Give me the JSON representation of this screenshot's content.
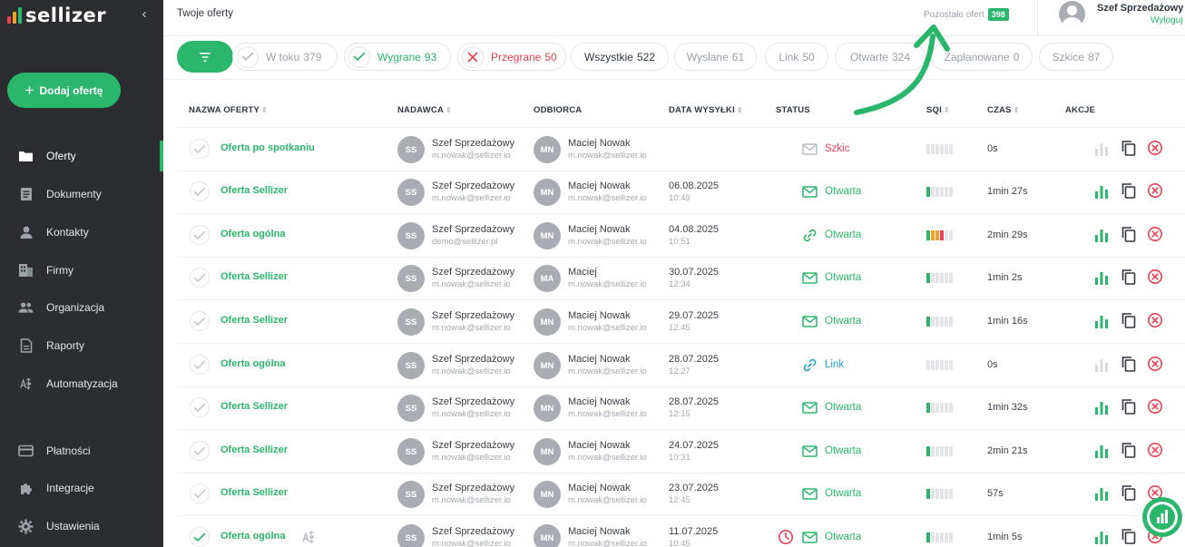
{
  "app": {
    "name": "sellizer"
  },
  "sidebar": {
    "add_offer_label": "Dodaj ofertę",
    "items": [
      {
        "label": "Oferty",
        "icon": "folder-icon",
        "active": true
      },
      {
        "label": "Dokumenty",
        "icon": "document-icon",
        "active": false
      },
      {
        "label": "Kontakty",
        "icon": "person-icon",
        "active": false
      },
      {
        "label": "Firmy",
        "icon": "building-icon",
        "active": false
      },
      {
        "label": "Organizacja",
        "icon": "group-icon",
        "active": false
      },
      {
        "label": "Raporty",
        "icon": "report-icon",
        "active": false
      },
      {
        "label": "Automatyzacja",
        "icon": "automation-icon",
        "active": false
      },
      {
        "label": "Płatności",
        "icon": "card-icon",
        "active": false
      },
      {
        "label": "Integracje",
        "icon": "puzzle-icon",
        "active": false
      },
      {
        "label": "Ustawienia",
        "icon": "gear-icon",
        "active": false
      }
    ]
  },
  "header": {
    "title": "Twoje oferty",
    "remaining_label": "Pozostało ofert",
    "remaining_count": "398",
    "user_name": "Szef Sprzedażowy",
    "logout_label": "Wyloguj"
  },
  "filters": [
    {
      "label": "W toku",
      "count": "379",
      "icon": "check-icon"
    },
    {
      "label": "Wygrane",
      "count": "93",
      "icon": "check-icon"
    },
    {
      "label": "Przegrane",
      "count": "50",
      "icon": "x-icon"
    },
    {
      "label": "Wszystkie",
      "count": "522",
      "icon": "",
      "active": true
    },
    {
      "label": "Wysłane",
      "count": "61",
      "icon": ""
    },
    {
      "label": "Link",
      "count": "50",
      "icon": ""
    },
    {
      "label": "Otwarte",
      "count": "324",
      "icon": ""
    },
    {
      "label": "Zaplanowane",
      "count": "0",
      "icon": ""
    },
    {
      "label": "Szkice",
      "count": "87",
      "icon": ""
    }
  ],
  "table": {
    "columns": [
      "NAZWA OFERTY",
      "NADAWCA",
      "ODBIORCA",
      "DATA WYSYŁKI",
      "STATUS",
      "SQI",
      "CZAS",
      "AKCJE"
    ],
    "rows": [
      {
        "name": "Oferta po spotkaniu",
        "sender_initials": "SS",
        "sender_name": "Szef Sprzedażowy",
        "sender_email": "m.nowak@sellizer.io",
        "recipient_initials": "MN",
        "recipient_name": "Maciej Nowak",
        "recipient_email": "m.nowak@sellizer.io",
        "date": "",
        "time": "",
        "status": "Szkic",
        "status_type": "draft",
        "status_icon": "envelope-icon",
        "sqi": 0,
        "duration": "0s",
        "stats_active": false,
        "checked": false,
        "automation": false,
        "scheduled": false
      },
      {
        "name": "Oferta Sellizer",
        "sender_initials": "SS",
        "sender_name": "Szef Sprzedażowy",
        "sender_email": "m.nowak@sellizer.io",
        "recipient_initials": "MN",
        "recipient_name": "Maciej Nowak",
        "recipient_email": "m.nowak@sellizer.io",
        "date": "06.08.2025",
        "time": "10:49",
        "status": "Otwarta",
        "status_type": "opened",
        "status_icon": "envelope-icon",
        "sqi": 1,
        "duration": "1min 27s",
        "stats_active": true,
        "checked": false,
        "automation": false,
        "scheduled": false
      },
      {
        "name": "Oferta ogólna",
        "sender_initials": "SS",
        "sender_name": "Szef Sprzedażowy",
        "sender_email": "demo@sellizer.pl",
        "recipient_initials": "MN",
        "recipient_name": "Maciej Nowak",
        "recipient_email": "m.nowak@sellizer.io",
        "date": "04.08.2025",
        "time": "10:51",
        "status": "Otwarta",
        "status_type": "opened",
        "status_icon": "link-icon",
        "sqi": 4,
        "duration": "2min 29s",
        "stats_active": true,
        "checked": false,
        "automation": false,
        "scheduled": false
      },
      {
        "name": "Oferta Sellizer",
        "sender_initials": "SS",
        "sender_name": "Szef Sprzedażowy",
        "sender_email": "m.nowak@sellizer.io",
        "recipient_initials": "MA",
        "recipient_name": "Maciej",
        "recipient_email": "m.nowak@sellizer.io",
        "date": "30.07.2025",
        "time": "12:34",
        "status": "Otwarta",
        "status_type": "opened",
        "status_icon": "envelope-icon",
        "sqi": 1,
        "duration": "1min 2s",
        "stats_active": true,
        "checked": false,
        "automation": false,
        "scheduled": false
      },
      {
        "name": "Oferta Sellizer",
        "sender_initials": "SS",
        "sender_name": "Szef Sprzedażowy",
        "sender_email": "m.nowak@sellizer.io",
        "recipient_initials": "MN",
        "recipient_name": "Maciej Nowak",
        "recipient_email": "m.nowak@sellizer.io",
        "date": "29.07.2025",
        "time": "12:45",
        "status": "Otwarta",
        "status_type": "opened",
        "status_icon": "envelope-icon",
        "sqi": 1,
        "duration": "1min 16s",
        "stats_active": true,
        "checked": false,
        "automation": false,
        "scheduled": false
      },
      {
        "name": "Oferta ogólna",
        "sender_initials": "SS",
        "sender_name": "Szef Sprzedażowy",
        "sender_email": "m.nowak@sellizer.io",
        "recipient_initials": "MN",
        "recipient_name": "Maciej Nowak",
        "recipient_email": "m.nowak@sellizer.io",
        "date": "28.07.2025",
        "time": "12:27",
        "status": "Link",
        "status_type": "link",
        "status_icon": "link-icon",
        "sqi": 0,
        "duration": "0s",
        "stats_active": false,
        "checked": false,
        "automation": false,
        "scheduled": false
      },
      {
        "name": "Oferta Sellizer",
        "sender_initials": "SS",
        "sender_name": "Szef Sprzedażowy",
        "sender_email": "m.nowak@sellizer.io",
        "recipient_initials": "MN",
        "recipient_name": "Maciej Nowak",
        "recipient_email": "m.nowak@sellizer.io",
        "date": "28.07.2025",
        "time": "12:15",
        "status": "Otwarta",
        "status_type": "opened",
        "status_icon": "envelope-icon",
        "sqi": 1,
        "duration": "1min 32s",
        "stats_active": true,
        "checked": false,
        "automation": false,
        "scheduled": false
      },
      {
        "name": "Oferta Sellizer",
        "sender_initials": "SS",
        "sender_name": "Szef Sprzedażowy",
        "sender_email": "m.nowak@sellizer.io",
        "recipient_initials": "MN",
        "recipient_name": "Maciej Nowak",
        "recipient_email": "m.nowak@sellizer.io",
        "date": "24.07.2025",
        "time": "10:31",
        "status": "Otwarta",
        "status_type": "opened",
        "status_icon": "envelope-icon",
        "sqi": 1,
        "duration": "2min 21s",
        "stats_active": true,
        "checked": false,
        "automation": false,
        "scheduled": false
      },
      {
        "name": "Oferta Sellizer",
        "sender_initials": "SS",
        "sender_name": "Szef Sprzedażowy",
        "sender_email": "m.nowak@sellizer.io",
        "recipient_initials": "MN",
        "recipient_name": "Maciej Nowak",
        "recipient_email": "m.nowak@sellizer.io",
        "date": "23.07.2025",
        "time": "12:45",
        "status": "Otwarta",
        "status_type": "opened",
        "status_icon": "envelope-icon",
        "sqi": 1,
        "duration": "57s",
        "stats_active": true,
        "checked": false,
        "automation": false,
        "scheduled": false
      },
      {
        "name": "Oferta ogólna",
        "sender_initials": "SS",
        "sender_name": "Szef Sprzedażowy",
        "sender_email": "m.nowak@sellizer.io",
        "recipient_initials": "MN",
        "recipient_name": "Maciej Nowak",
        "recipient_email": "m.nowak@sellizer.io",
        "date": "11.07.2025",
        "time": "10:45",
        "status": "Otwarta",
        "status_type": "opened",
        "status_icon": "envelope-icon",
        "sqi": 1,
        "duration": "1min 5s",
        "stats_active": true,
        "checked": true,
        "automation": true,
        "scheduled": true
      }
    ]
  },
  "colors": {
    "brand_green": "#2ab76b",
    "danger_red": "#e8414f",
    "link_blue": "#1fa4c6",
    "sidebar_bg": "#2b2d31",
    "sqi_orange": "#f0a02a"
  }
}
